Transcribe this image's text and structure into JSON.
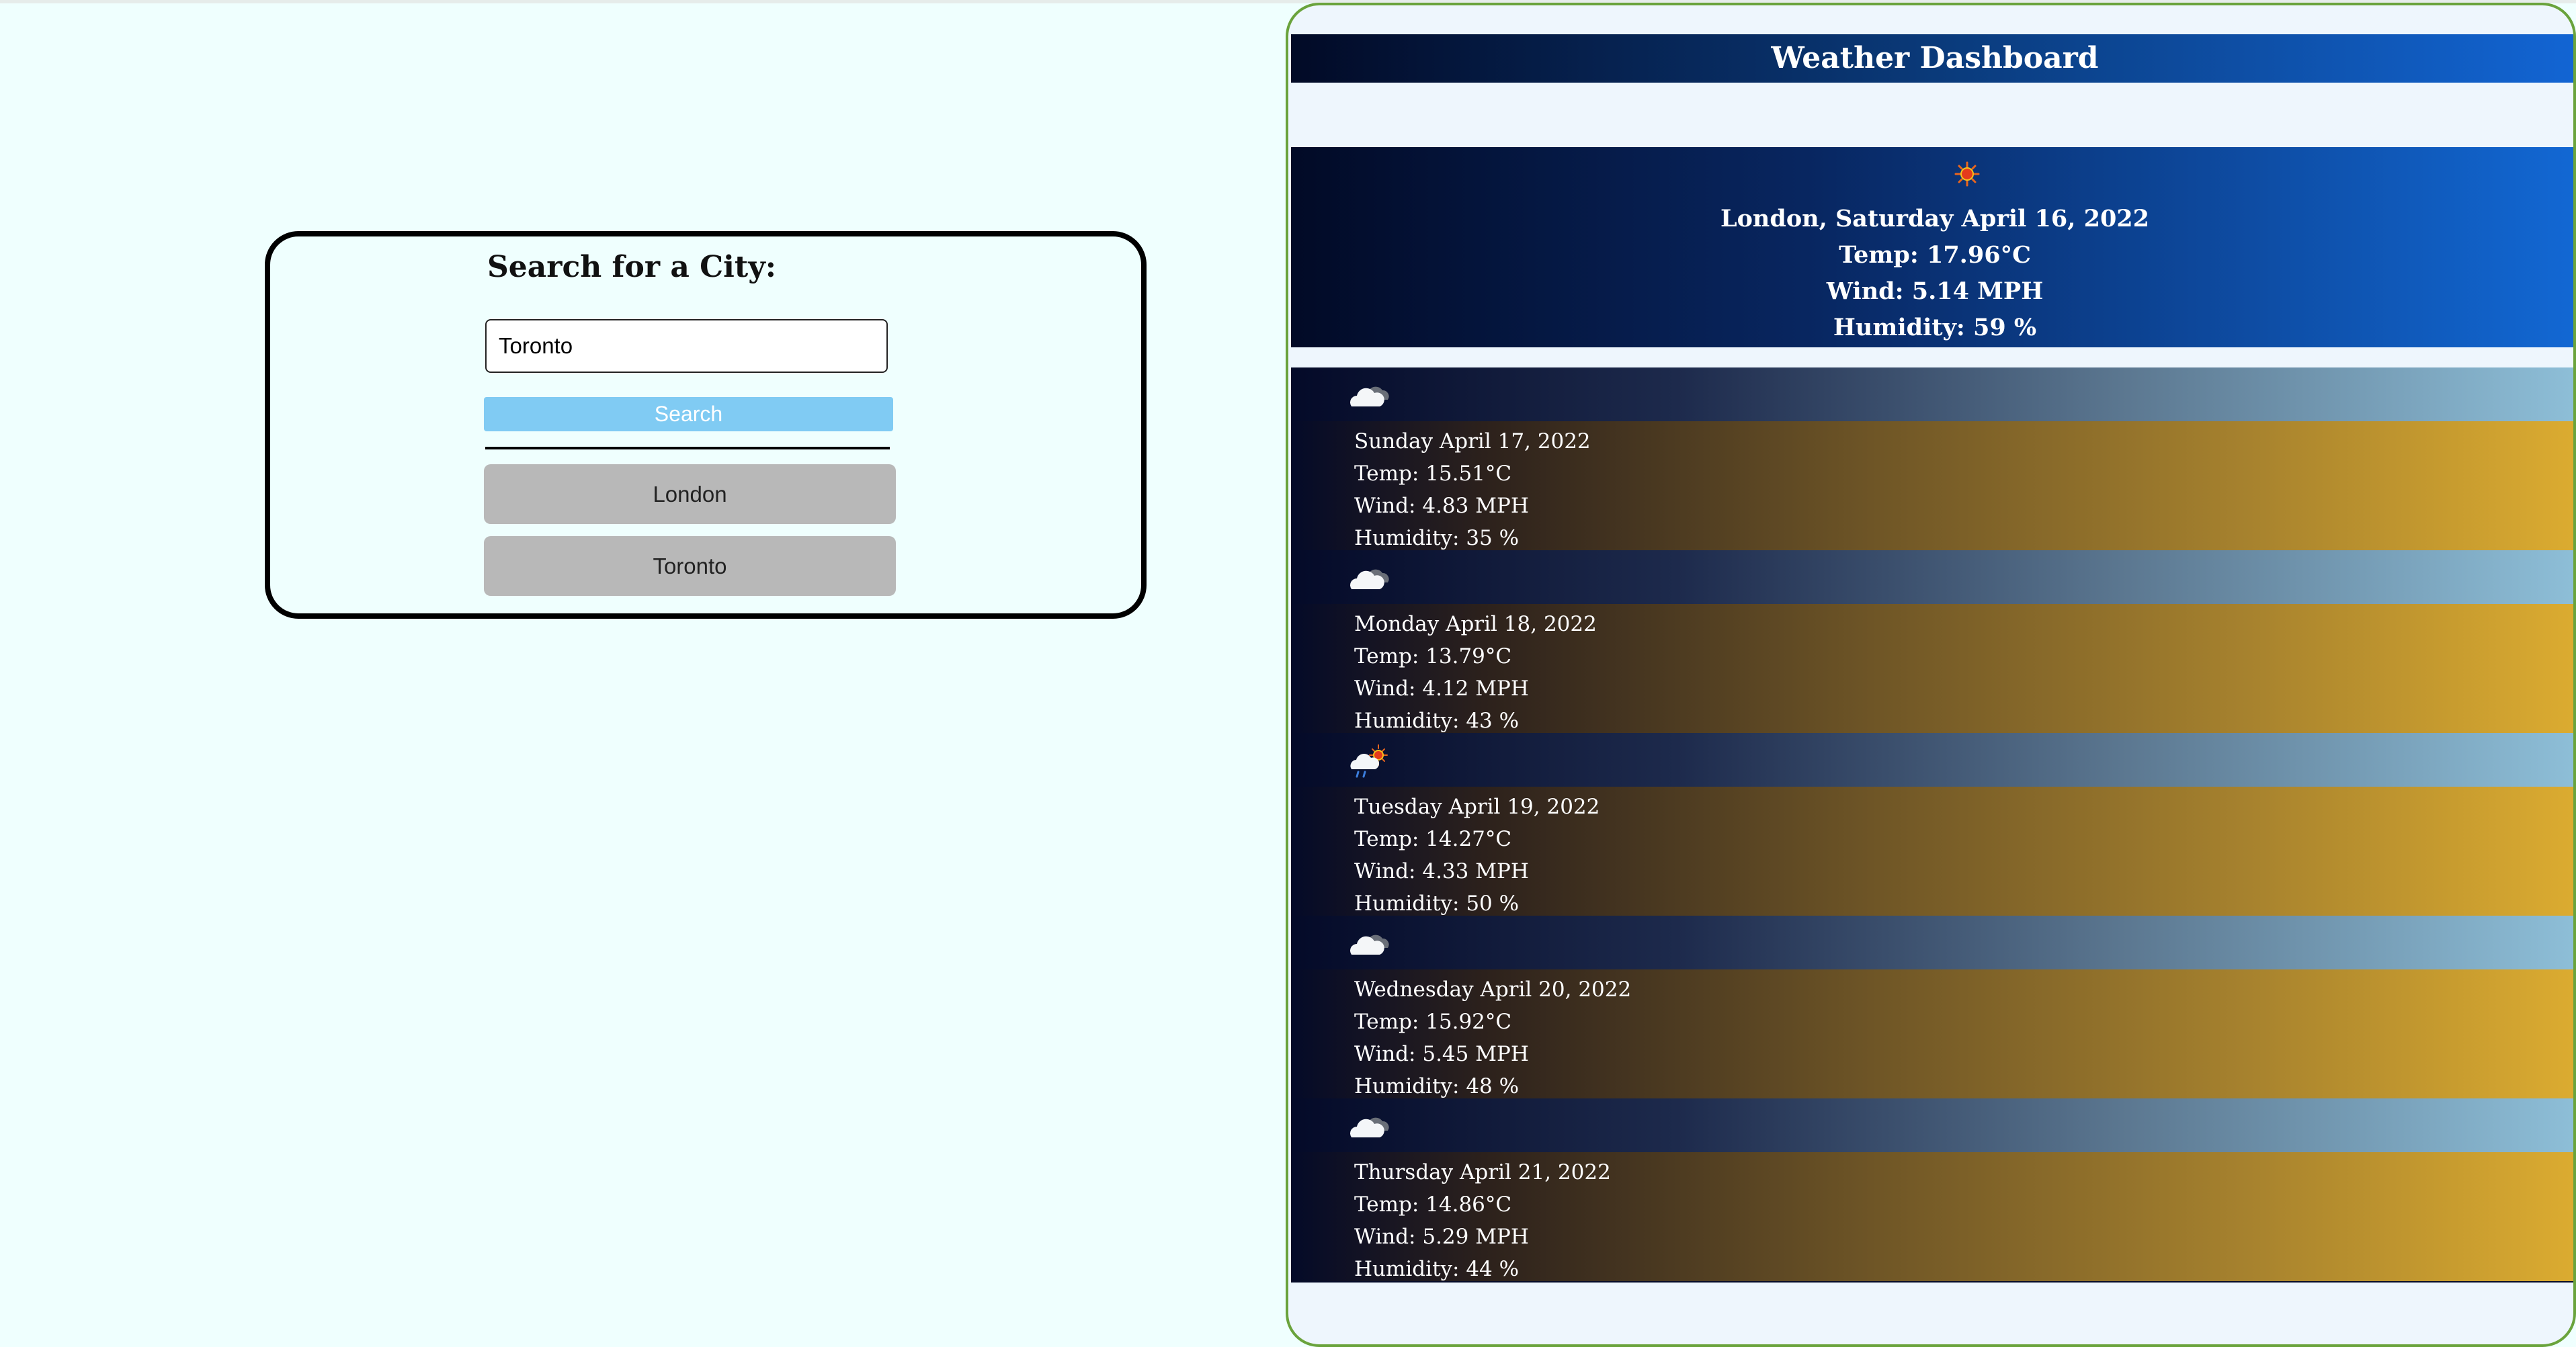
{
  "search": {
    "title": "Search for a City:",
    "input_value": "Toronto",
    "button_label": "Search",
    "history": [
      "London",
      "Toronto"
    ]
  },
  "dashboard": {
    "title": "Weather Dashboard",
    "current": {
      "icon": "sun-icon",
      "city_date": "London, Saturday April 16, 2022",
      "temp": "Temp: 17.96°C",
      "wind": "Wind: 5.14 MPH",
      "humidity": "Humidity: 59 %"
    },
    "forecast": [
      {
        "icon": "cloud-icon",
        "date": "Sunday April 17, 2022",
        "temp": "Temp: 15.51°C",
        "wind": "Wind: 4.83 MPH",
        "humidity": "Humidity: 35 %"
      },
      {
        "icon": "cloud-icon",
        "date": "Monday April 18, 2022",
        "temp": "Temp: 13.79°C",
        "wind": "Wind: 4.12 MPH",
        "humidity": "Humidity: 43 %"
      },
      {
        "icon": "rain-sun-icon",
        "date": "Tuesday April 19, 2022",
        "temp": "Temp: 14.27°C",
        "wind": "Wind: 4.33 MPH",
        "humidity": "Humidity: 50 %"
      },
      {
        "icon": "cloud-icon",
        "date": "Wednesday April 20, 2022",
        "temp": "Temp: 15.92°C",
        "wind": "Wind: 5.45 MPH",
        "humidity": "Humidity: 48 %"
      },
      {
        "icon": "cloud-icon",
        "date": "Thursday April 21, 2022",
        "temp": "Temp: 14.86°C",
        "wind": "Wind: 5.29 MPH",
        "humidity": "Humidity: 44 %"
      }
    ]
  },
  "colors": {
    "page_bg": "#effffe",
    "search_button": "#80cbf3",
    "history_button": "#b8b8b8",
    "dashboard_border": "#6aa33c",
    "header_dark": "#020a26",
    "header_blue": "#1265d4",
    "forecast_gold": "#dcac30"
  }
}
